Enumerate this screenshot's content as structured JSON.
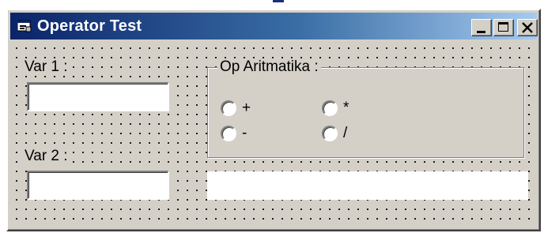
{
  "window": {
    "title": "Operator Test",
    "titlebar_gradient": [
      "#0a246a",
      "#a6caf0"
    ],
    "controls": {
      "minimize_icon": "minimize-icon",
      "maximize_icon": "maximize-icon",
      "close_glyph": "✕"
    }
  },
  "form": {
    "var1": {
      "label": "Var 1 :",
      "value": ""
    },
    "var2": {
      "label": "Var 2 :",
      "value": ""
    },
    "operators": {
      "group_label": "Op Aritmatika :",
      "options": [
        {
          "label": "+"
        },
        {
          "label": "*"
        },
        {
          "label": "-"
        },
        {
          "label": "/"
        }
      ]
    },
    "result": {
      "value": ""
    }
  },
  "colors": {
    "face": "#d4d0c8",
    "field": "#ffffff",
    "title_text": "#ffffff"
  }
}
